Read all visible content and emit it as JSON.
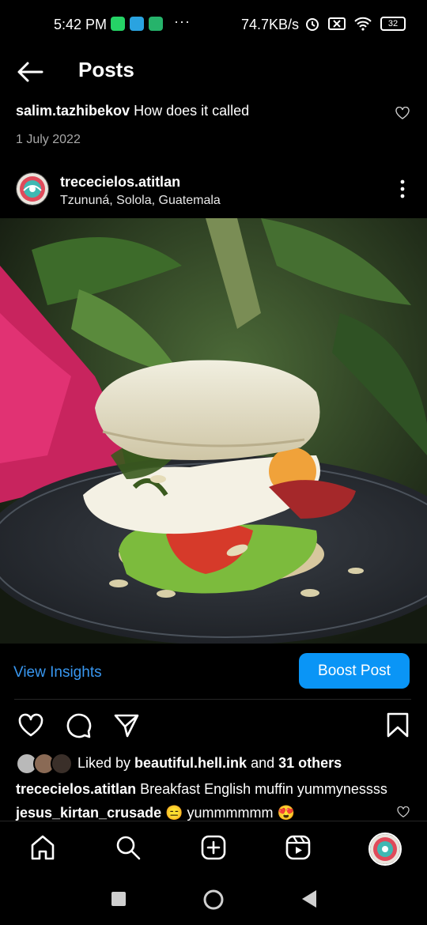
{
  "status_bar": {
    "time": "5:42 PM",
    "dots": "···",
    "net_speed": "74.7KB/s",
    "battery": "32",
    "app_icons": [
      "whatsapp-icon",
      "telegram-icon",
      "shield-app-icon"
    ],
    "system_icons": [
      "alarm-icon",
      "no-sim-icon",
      "wifi-icon",
      "battery-icon"
    ]
  },
  "header": {
    "title": "Posts"
  },
  "top_comment": {
    "user": "salim.tazhibekov",
    "text": " How does it called",
    "date": "1 July 2022"
  },
  "post": {
    "account": "trececielos.atitlan",
    "location": "Tzununá, Solola, Guatemala",
    "image_subject": "english-muffin-breakfast-sandwich"
  },
  "insights": {
    "view_label": "View Insights",
    "boost_label": "Boost Post"
  },
  "likes": {
    "prefix": "Liked by ",
    "user": "beautiful.hell.ink",
    "middle": " and ",
    "others": "31 others"
  },
  "caption": {
    "user": "trececielos.atitlan",
    "text": " Breakfast English muffin yummynessss"
  },
  "comment": {
    "user": "jesus_kirtan_crusade",
    "text": " 😑 yummmmmm 😍"
  },
  "colors": {
    "background": "#000000",
    "link_blue": "#3897f0",
    "boost_blue": "#0a95f6",
    "muted_text": "#a8a8a8"
  }
}
